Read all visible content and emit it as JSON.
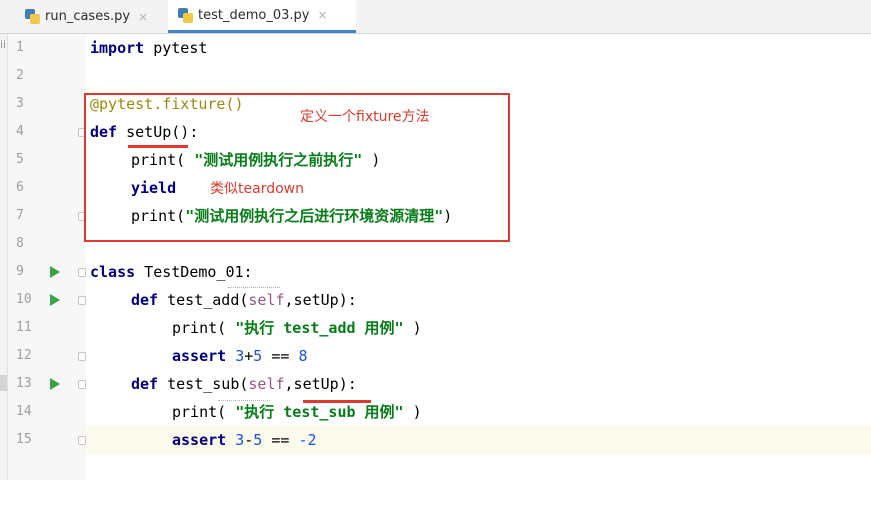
{
  "tabs": [
    {
      "label": "run_cases.py",
      "close": "×"
    },
    {
      "label": "test_demo_03.py",
      "close": "×"
    }
  ],
  "left_strip_char": "ii",
  "lines": [
    {
      "num": "1"
    },
    {
      "num": "2"
    },
    {
      "num": "3"
    },
    {
      "num": "4"
    },
    {
      "num": "5"
    },
    {
      "num": "6"
    },
    {
      "num": "7"
    },
    {
      "num": "8"
    },
    {
      "num": "9"
    },
    {
      "num": "10"
    },
    {
      "num": "11"
    },
    {
      "num": "12"
    },
    {
      "num": "13"
    },
    {
      "num": "14"
    },
    {
      "num": "15"
    }
  ],
  "code": {
    "l1_kw": "import",
    "l1_rest": " pytest",
    "l3": "@pytest.fixture()",
    "l4_kw": "def",
    "l4_fn": "setUp",
    "l4_rest": "():",
    "l5_fn": "print(",
    "l5_str": " \"测试用例执行之前执行\" ",
    "l5_end": ")",
    "l6_kw": "yield",
    "l7_fn": "print(",
    "l7_str": "\"测试用例执行之后进行环境资源清理\"",
    "l7_end": ")",
    "l9_kw": "class",
    "l9_rest": " TestDemo_01:",
    "l10_kw": "def",
    "l10_fn": " test_add(",
    "l10_self": "self",
    "l10_rest": ",setUp):",
    "l11_fn": "print(",
    "l11_str": " \"执行 test_add 用例\" ",
    "l11_end": ")",
    "l12_kw": "assert",
    "l12_a": " 3",
    "l12_op": "+",
    "l12_b": "5",
    "l12_eq": " == ",
    "l12_c": "8",
    "l13_kw": "def",
    "l13_fn": " test_sub(",
    "l13_self": "self",
    "l13_rest": ",setUp):",
    "l14_fn": "print(",
    "l14_str": " \"执行 test_sub 用例\" ",
    "l14_end": ")",
    "l15_kw": "assert",
    "l15_a": " 3",
    "l15_op": "-",
    "l15_b": "5",
    "l15_eq": " == ",
    "l15_c": "-2"
  },
  "annotations": {
    "fixture_note": "定义一个fixture方法",
    "yield_note": "类似teardown"
  },
  "colors": {
    "keyword": "#000080",
    "string": "#067d17",
    "decorator": "#9e880d",
    "number": "#1750eb",
    "self": "#94558d",
    "annotation": "#e0392b",
    "current_line": "#fcfaed"
  }
}
